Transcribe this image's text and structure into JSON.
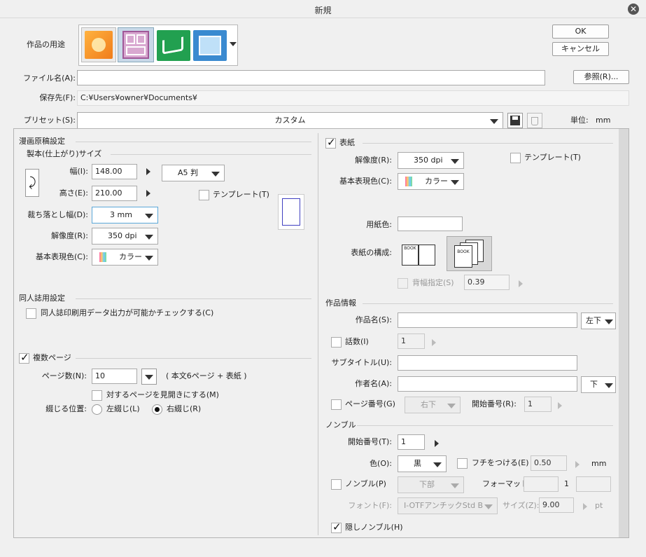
{
  "window": {
    "title": "新規"
  },
  "header": {
    "usage_label": "作品の用途",
    "usage_icons": [
      "illustration-icon",
      "comic-icon",
      "book-icon",
      "animation-icon"
    ],
    "ok": "OK",
    "cancel": "キャンセル",
    "filename_label": "ファイル名(A):",
    "filename_value": "",
    "browse": "参照(R)...",
    "save_label": "保存先(F):",
    "save_value": "C:¥Users¥owner¥Documents¥",
    "preset_label": "プリセット(S):",
    "preset_value": "カスタム",
    "unit_label": "単位:",
    "unit_value": "mm"
  },
  "left": {
    "manga_title": "漫画原稿設定",
    "size_title": "製本(仕上がり)サイズ",
    "width_label": "幅(I):",
    "width_value": "148.00",
    "paper_value": "A5 判",
    "height_label": "高さ(E):",
    "height_value": "210.00",
    "template_label": "テンプレート(T)",
    "bleed_label": "裁ち落とし幅(D):",
    "bleed_value": "3 mm",
    "res_label": "解像度(R):",
    "res_value": "350 dpi",
    "color_label": "基本表現色(C):",
    "color_value": "カラー",
    "doujin_title": "同人誌用設定",
    "doujin_check": "同人誌印刷用データ出力が可能かチェックする(C)",
    "multi_title": "複数ページ",
    "pages_label": "ページ数(N):",
    "pages_value": "10",
    "pages_note": "( 本文6ページ + 表紙 )",
    "spread_label": "対するページを見開きにする(M)",
    "binding_label": "綴じる位置:",
    "left_bind": "左綴じ(L)",
    "right_bind": "右綴じ(R)"
  },
  "right": {
    "cover_title": "表紙",
    "res_label": "解像度(R):",
    "res_value": "350 dpi",
    "template_label": "テンプレート(T)",
    "color_label": "基本表現色(C):",
    "color_value": "カラー",
    "paper_color_label": "用紙色:",
    "cover_struct_label": "表紙の構成:",
    "book_label": "BOOK",
    "spine_label": "背幅指定(S)",
    "spine_value": "0.39",
    "work_title": "作品情報",
    "work_name_label": "作品名(S):",
    "pos_value": "左下",
    "episode_label": "話数(I)",
    "episode_value": "1",
    "subtitle_label": "サブタイトル(U):",
    "author_label": "作者名(A):",
    "author_pos": "下",
    "page_num_label": "ページ番号(G)",
    "page_num_pos": "右下",
    "start_label": "開始番号(R):",
    "start_value": "1",
    "nombre_title": "ノンブル",
    "nombre_start_label": "開始番号(T):",
    "nombre_start_value": "1",
    "color_lbl": "色(O):",
    "color_val": "黒",
    "border_label": "フチをつける(E)",
    "border_value": "0.50",
    "mm": "mm",
    "nombre_label": "ノンブル(P)",
    "nombre_pos": "下部",
    "format_label": "フォーマット:",
    "format_mid": "1",
    "font_label": "フォント(F):",
    "font_value": "I-OTFアンチックStd B",
    "size_label": "サイズ(Z):",
    "size_value": "9.00",
    "pt": "pt",
    "hidden_label": "隠しノンブル(H)"
  }
}
